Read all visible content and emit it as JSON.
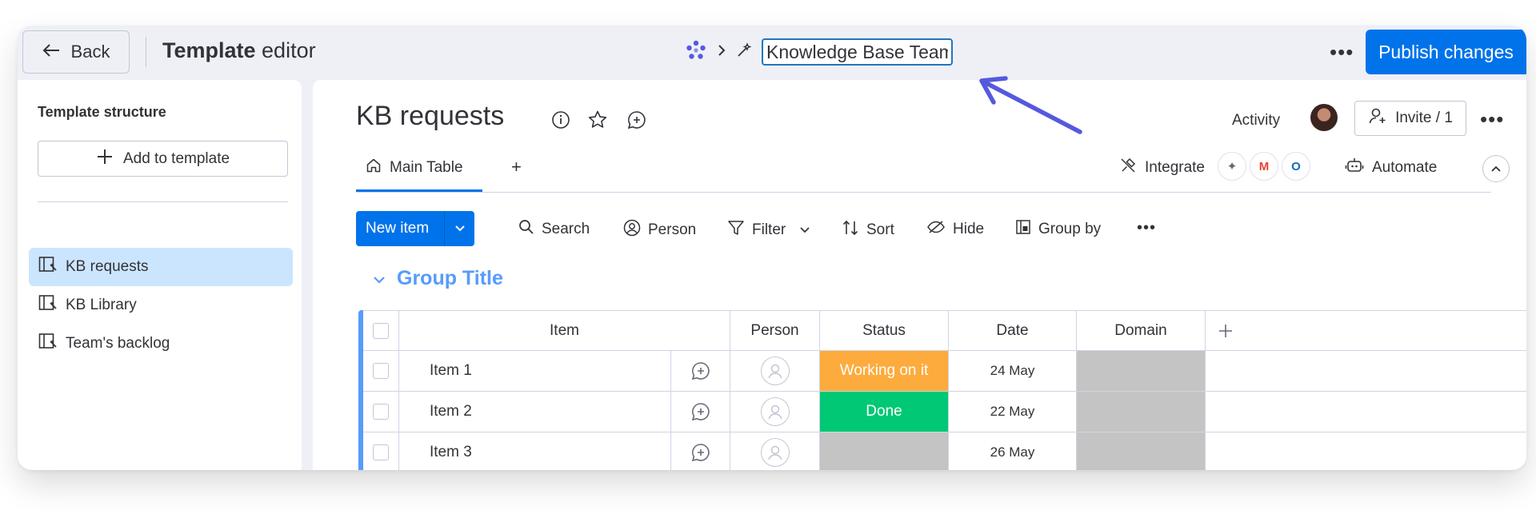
{
  "topbar": {
    "back_label": "Back",
    "title_bold": "Template",
    "title_rest": " editor",
    "template_name": "Knowledge Base Team",
    "publish_label": "Publish changes"
  },
  "sidebar": {
    "title": "Template structure",
    "add_label": "Add to template",
    "items": [
      {
        "label": "KB requests",
        "active": true
      },
      {
        "label": "KB Library",
        "active": false
      },
      {
        "label": "Team's backlog",
        "active": false
      }
    ]
  },
  "board": {
    "title": "KB requests",
    "activity_label": "Activity",
    "invite_label": "Invite / 1",
    "tab_label": "Main Table",
    "integrate_label": "Integrate",
    "automate_label": "Automate"
  },
  "toolbar": {
    "new_item_label": "New item",
    "search_label": "Search",
    "person_label": "Person",
    "filter_label": "Filter",
    "sort_label": "Sort",
    "hide_label": "Hide",
    "group_by_label": "Group by"
  },
  "group": {
    "title": "Group Title",
    "columns": [
      "Item",
      "Person",
      "Status",
      "Date",
      "Domain"
    ],
    "rows": [
      {
        "item": "Item 1",
        "status": "Working on it",
        "status_color": "#fdab3d",
        "date": "24 May"
      },
      {
        "item": "Item 2",
        "status": "Done",
        "status_color": "#00c875",
        "date": "22 May"
      },
      {
        "item": "Item 3",
        "status": "",
        "status_color": "#c4c4c4",
        "date": "26 May"
      }
    ]
  },
  "colors": {
    "primary": "#0073ea",
    "group": "#579bfc",
    "empty_cell": "#c4c4c4",
    "annotation_arrow": "#5559df"
  }
}
